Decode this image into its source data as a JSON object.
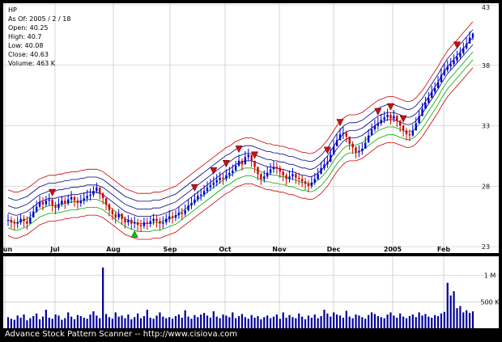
{
  "chart_data": {
    "type": "candlestick",
    "ticker": "HP",
    "info": {
      "as_of": "As Of: 2005 / 2 / 18",
      "open": "Open: 40.25",
      "high": "High: 40.7",
      "low": "Low: 40.08",
      "close": "Close: 40.63",
      "volume": "Volume: 463 K"
    },
    "y_ticks": [
      "43",
      "38",
      "33",
      "28",
      "23"
    ],
    "ylim": [
      23,
      43
    ],
    "x_ticks": [
      "Jun",
      "Jul",
      "Aug",
      "Sep",
      "Oct",
      "Nov",
      "Dec",
      "2005",
      "Feb"
    ],
    "volume_ticks": [
      "1 M",
      "500 K"
    ],
    "volume_max_k": 1300,
    "footer": "Advance Stock Pattern Scanner -- http://www.cisiova.com",
    "colors": {
      "up_candle": "#0000cc",
      "down_candle": "#cc0000",
      "band_red": "#cc0000",
      "band_green": "#00aa00",
      "band_blue": "#000080",
      "marker_down": "#d01010",
      "marker_up": "#10c010",
      "volume_bar": "#000099",
      "grid": "#bbbbbb"
    },
    "closes": [
      25.2,
      25.0,
      24.9,
      25.0,
      25.3,
      25.1,
      24.9,
      25.4,
      25.9,
      26.3,
      26.7,
      26.5,
      26.8,
      26.9,
      26.4,
      26.2,
      26.5,
      26.8,
      26.6,
      26.9,
      27.1,
      26.8,
      26.6,
      26.8,
      27.0,
      27.2,
      27.3,
      27.6,
      27.9,
      27.4,
      27.0,
      26.5,
      26.0,
      25.7,
      25.4,
      25.7,
      25.3,
      25.0,
      25.2,
      24.9,
      25.0,
      24.8,
      24.7,
      25.0,
      24.9,
      25.1,
      25.3,
      25.1,
      24.9,
      25.0,
      25.3,
      25.5,
      25.4,
      25.6,
      25.8,
      25.7,
      26.0,
      26.4,
      26.6,
      26.9,
      27.2,
      27.3,
      27.6,
      27.9,
      28.1,
      28.3,
      28.5,
      28.7,
      28.6,
      28.9,
      29.1,
      29.3,
      29.7,
      30.1,
      29.8,
      30.4,
      30.6,
      30.1,
      29.6,
      29.0,
      28.6,
      28.8,
      29.1,
      29.4,
      29.6,
      29.5,
      29.2,
      28.9,
      28.6,
      28.8,
      29.0,
      28.7,
      28.6,
      28.4,
      28.2,
      28.0,
      28.3,
      28.6,
      29.0,
      29.5,
      29.8,
      30.0,
      30.6,
      31.3,
      31.8,
      32.3,
      32.4,
      32.1,
      31.5,
      31.2,
      30.8,
      30.9,
      31.1,
      31.6,
      32.2,
      32.7,
      33.0,
      33.2,
      33.5,
      33.7,
      33.9,
      33.6,
      33.8,
      33.4,
      33.0,
      32.6,
      32.3,
      32.2,
      32.6,
      33.2,
      33.8,
      34.4,
      34.9,
      35.3,
      35.8,
      36.1,
      36.6,
      37.2,
      37.6,
      37.9,
      38.1,
      38.4,
      38.7,
      39.0,
      39.4,
      39.8,
      40.3,
      40.63
    ],
    "highs": [
      25.7,
      25.5,
      25.3,
      25.5,
      25.7,
      25.6,
      25.5,
      25.9,
      26.4,
      26.8,
      27.2,
      27.1,
      27.2,
      27.4,
      27.0,
      26.7,
      27.0,
      27.2,
      27.1,
      27.3,
      27.6,
      27.2,
      27.1,
      27.3,
      27.5,
      27.7,
      27.8,
      28.0,
      28.3,
      27.9,
      27.5,
      27.0,
      26.6,
      26.2,
      25.9,
      26.1,
      25.8,
      25.5,
      25.6,
      25.4,
      25.5,
      25.3,
      25.2,
      25.4,
      25.4,
      25.5,
      25.7,
      25.6,
      25.4,
      25.5,
      25.7,
      26.0,
      25.9,
      26.0,
      26.3,
      26.2,
      26.5,
      26.9,
      27.1,
      27.4,
      27.6,
      27.8,
      28.1,
      28.4,
      28.6,
      28.8,
      29.0,
      29.2,
      29.1,
      29.4,
      29.6,
      29.8,
      30.1,
      30.6,
      30.3,
      30.9,
      31.1,
      30.6,
      30.1,
      29.5,
      29.1,
      29.3,
      29.6,
      29.9,
      30.1,
      30.0,
      29.7,
      29.4,
      29.1,
      29.3,
      29.5,
      29.2,
      29.1,
      28.9,
      28.7,
      28.5,
      28.8,
      29.1,
      29.5,
      30.0,
      30.3,
      30.5,
      31.1,
      31.8,
      32.3,
      32.8,
      32.9,
      32.6,
      32.0,
      31.7,
      31.3,
      31.4,
      31.6,
      32.1,
      32.7,
      33.2,
      33.5,
      33.7,
      34.0,
      34.2,
      34.4,
      34.1,
      34.3,
      33.9,
      33.5,
      33.1,
      32.8,
      32.7,
      33.1,
      33.7,
      34.3,
      34.9,
      35.4,
      35.8,
      36.3,
      36.6,
      37.1,
      37.7,
      38.1,
      38.4,
      38.6,
      38.9,
      39.2,
      39.5,
      39.9,
      40.3,
      40.8,
      40.7
    ],
    "lows": [
      24.7,
      24.5,
      24.4,
      24.5,
      24.8,
      24.6,
      24.4,
      24.9,
      25.4,
      25.8,
      26.2,
      26.0,
      26.3,
      26.4,
      25.9,
      25.7,
      26.0,
      26.3,
      26.1,
      26.4,
      26.6,
      26.3,
      26.1,
      26.3,
      26.5,
      26.7,
      26.8,
      27.1,
      27.4,
      26.9,
      26.5,
      26.0,
      25.5,
      25.2,
      24.9,
      25.2,
      24.8,
      24.5,
      24.7,
      24.4,
      24.5,
      24.3,
      24.2,
      24.5,
      24.4,
      24.6,
      24.8,
      24.6,
      24.4,
      24.5,
      24.8,
      25.0,
      24.9,
      25.1,
      25.3,
      25.2,
      25.5,
      25.9,
      26.1,
      26.4,
      26.7,
      26.8,
      27.1,
      27.4,
      27.6,
      27.8,
      28.0,
      28.2,
      28.1,
      28.4,
      28.6,
      28.8,
      29.2,
      29.6,
      29.3,
      29.9,
      30.1,
      29.6,
      29.1,
      28.5,
      28.1,
      28.3,
      28.6,
      28.9,
      29.1,
      29.0,
      28.7,
      28.4,
      28.1,
      28.3,
      28.5,
      28.2,
      28.1,
      27.9,
      27.7,
      27.5,
      27.8,
      28.1,
      28.5,
      29.0,
      29.3,
      29.5,
      30.1,
      30.8,
      31.3,
      31.8,
      31.9,
      31.6,
      31.0,
      30.7,
      30.3,
      30.4,
      30.6,
      31.1,
      31.7,
      32.2,
      32.5,
      32.7,
      33.0,
      33.2,
      33.4,
      33.1,
      33.3,
      32.9,
      32.5,
      32.1,
      31.8,
      31.7,
      32.1,
      32.7,
      33.3,
      33.9,
      34.4,
      34.8,
      35.3,
      35.6,
      36.1,
      36.7,
      37.1,
      37.4,
      37.6,
      37.9,
      38.2,
      38.5,
      38.9,
      39.3,
      39.8,
      40.08
    ],
    "bands_mid": [
      25.8,
      25.7,
      25.6,
      25.6,
      25.7,
      25.8,
      25.9,
      26.1,
      26.3,
      26.5,
      26.7,
      26.8,
      26.9,
      27.0,
      27.0,
      27.0,
      27.1,
      27.1,
      27.2,
      27.2,
      27.3,
      27.3,
      27.3,
      27.4,
      27.4,
      27.5,
      27.5,
      27.5,
      27.5,
      27.4,
      27.3,
      27.1,
      26.9,
      26.7,
      26.5,
      26.3,
      26.1,
      25.9,
      25.8,
      25.7,
      25.6,
      25.5,
      25.5,
      25.5,
      25.5,
      25.5,
      25.6,
      25.6,
      25.6,
      25.7,
      25.8,
      25.9,
      26.0,
      26.1,
      26.3,
      26.5,
      26.7,
      26.9,
      27.1,
      27.3,
      27.5,
      27.7,
      27.9,
      28.1,
      28.3,
      28.5,
      28.7,
      28.9,
      29.1,
      29.3,
      29.4,
      29.6,
      29.8,
      29.9,
      30.0,
      30.1,
      30.1,
      30.1,
      30.0,
      29.9,
      29.8,
      29.7,
      29.6,
      29.6,
      29.5,
      29.5,
      29.4,
      29.4,
      29.3,
      29.2,
      29.2,
      29.1,
      29.0,
      28.9,
      28.9,
      28.8,
      28.8,
      28.9,
      29.1,
      29.3,
      29.6,
      29.9,
      30.3,
      30.7,
      31.1,
      31.4,
      31.7,
      31.9,
      32.0,
      32.0,
      32.0,
      32.1,
      32.2,
      32.4,
      32.6,
      32.8,
      33.0,
      33.2,
      33.3,
      33.4,
      33.5,
      33.5,
      33.5,
      33.4,
      33.3,
      33.2,
      33.1,
      33.1,
      33.2,
      33.4,
      33.7,
      34.0,
      34.4,
      34.8,
      35.2,
      35.6,
      36.0,
      36.5,
      36.9,
      37.3,
      37.6,
      37.9,
      38.2,
      38.5,
      38.8,
      39.1,
      39.4,
      39.7
    ],
    "band_offsets": [
      1.9,
      1.25,
      0.6,
      0.0,
      -0.6,
      -1.25,
      -1.9
    ],
    "markers_down_index": [
      14,
      59,
      65,
      69,
      73,
      78,
      101,
      105,
      117,
      121,
      125,
      142,
      148
    ],
    "markers_up_index": [
      40
    ],
    "volumes_k": [
      210,
      180,
      160,
      240,
      200,
      260,
      150,
      190,
      230,
      280,
      170,
      220,
      350,
      200,
      180,
      260,
      240,
      160,
      190,
      300,
      220,
      170,
      250,
      230,
      200,
      180,
      260,
      320,
      240,
      190,
      1150,
      270,
      210,
      180,
      300,
      220,
      240,
      190,
      260,
      170,
      210,
      280,
      190,
      230,
      350,
      200,
      180,
      240,
      300,
      220,
      190,
      210,
      180,
      230,
      260,
      200,
      340,
      220,
      180,
      250,
      210,
      260,
      290,
      240,
      200,
      320,
      220,
      190,
      260,
      240,
      210,
      300,
      190,
      230,
      270,
      210,
      180,
      250,
      200,
      230,
      170,
      210,
      240,
      190,
      220,
      260,
      180,
      300,
      200,
      250,
      210,
      190,
      280,
      220,
      170,
      240,
      200,
      260,
      190,
      230,
      350,
      280,
      220,
      300,
      260,
      240,
      200,
      330,
      220,
      190,
      260,
      240,
      210,
      180,
      250,
      300,
      270,
      230,
      210,
      190,
      260,
      300,
      240,
      200,
      280,
      220,
      190,
      230,
      260,
      210,
      300,
      240,
      270,
      220,
      200,
      250,
      230,
      280,
      310,
      860,
      620,
      700,
      380,
      420,
      300,
      340,
      290,
      320,
      360,
      330,
      300
    ]
  }
}
